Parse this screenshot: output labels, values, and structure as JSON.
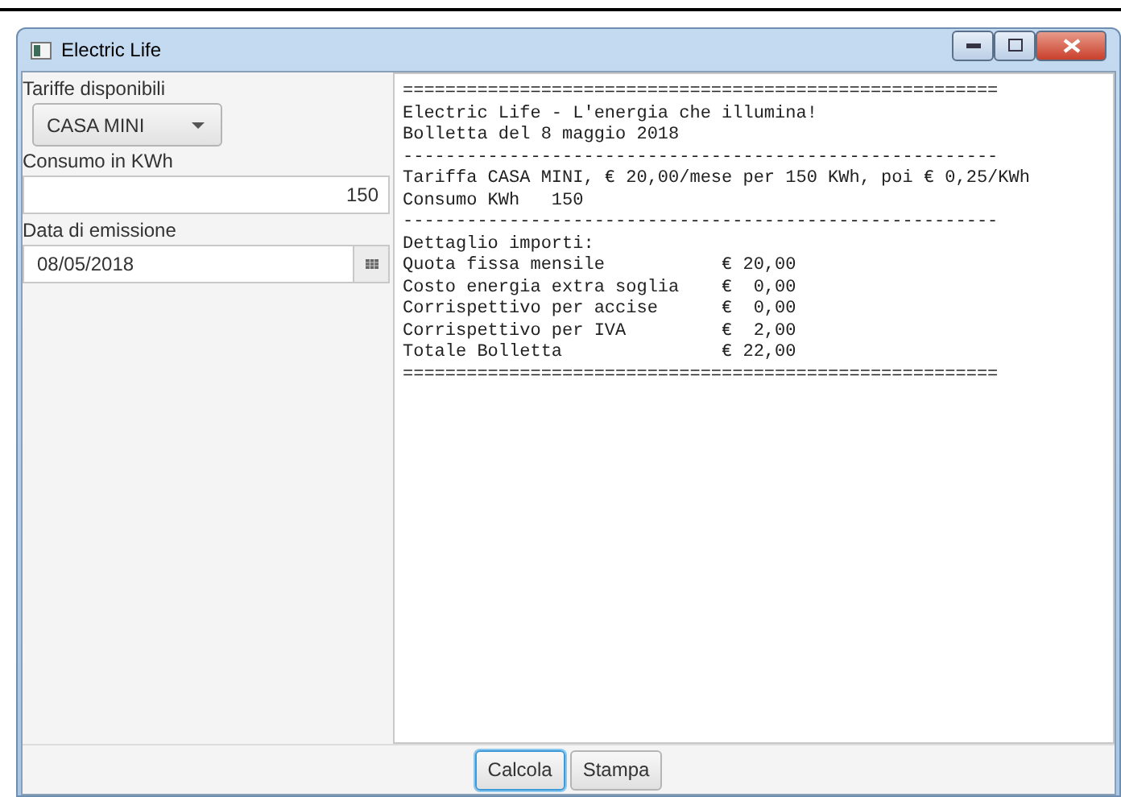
{
  "window": {
    "title": "Electric Life"
  },
  "form": {
    "tariff_label": "Tariffe disponibili",
    "tariff_value": "CASA MINI",
    "consumption_label": "Consumo in KWh",
    "consumption_value": "150",
    "date_label": "Data di emissione",
    "date_value": "08/05/2018"
  },
  "output_lines": [
    "========================================================",
    "Electric Life - L'energia che illumina!",
    "Bolletta del 8 maggio 2018",
    "--------------------------------------------------------",
    "Tariffa CASA MINI, € 20,00/mese per 150 KWh, poi € 0,25/KWh",
    "Consumo KWh   150",
    "--------------------------------------------------------",
    "Dettaglio importi:",
    "Quota fissa mensile           € 20,00",
    "Costo energia extra soglia    €  0,00",
    "Corrispettivo per accise      €  0,00",
    "Corrispettivo per IVA         €  2,00",
    "Totale Bolletta               € 22,00",
    "========================================================"
  ],
  "buttons": [
    {
      "label": "Calcola",
      "focused": true
    },
    {
      "label": "Stampa",
      "focused": false
    }
  ]
}
